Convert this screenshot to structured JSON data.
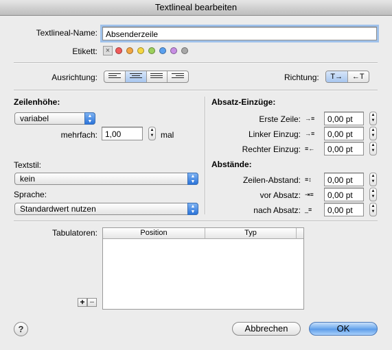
{
  "window": {
    "title": "Textlineal bearbeiten"
  },
  "name": {
    "label": "Textlineal-Name:",
    "value": "Absenderzeile"
  },
  "etikett": {
    "label": "Etikett:",
    "colors": [
      "#f05a5a",
      "#f1a542",
      "#f5d641",
      "#9bd05c",
      "#5aa0ef",
      "#c78ee3",
      "#a8a8a8"
    ]
  },
  "ausrichtung": {
    "label": "Ausrichtung:",
    "selected_index": 1
  },
  "richtung": {
    "label": "Richtung:",
    "options": [
      "T→",
      "←T"
    ],
    "selected_index": 0
  },
  "zeilenhoehe": {
    "heading": "Zeilenhöhe:",
    "mode": "variabel",
    "mehrfach_label": "mehrfach:",
    "mehrfach_value": "1,00",
    "unit": "mal"
  },
  "textstil": {
    "label": "Textstil:",
    "value": "kein"
  },
  "sprache": {
    "label": "Sprache:",
    "value": "Standardwert nutzen"
  },
  "absatz": {
    "heading": "Absatz-Einzüge:",
    "erste_zeile": {
      "label": "Erste Zeile:",
      "value": "0,00 pt"
    },
    "linker": {
      "label": "Linker Einzug:",
      "value": "0,00 pt"
    },
    "rechter": {
      "label": "Rechter Einzug:",
      "value": "0,00 pt"
    }
  },
  "abstaende": {
    "heading": "Abstände:",
    "zeilen": {
      "label": "Zeilen-Abstand:",
      "value": "0,00 pt"
    },
    "vor": {
      "label": "vor Absatz:",
      "value": "0,00 pt"
    },
    "nach": {
      "label": "nach Absatz:",
      "value": "0,00 pt"
    }
  },
  "tabulatoren": {
    "label": "Tabulatoren:",
    "columns": [
      "Position",
      "Typ"
    ],
    "add": "+",
    "remove": "−"
  },
  "buttons": {
    "help": "?",
    "cancel": "Abbrechen",
    "ok": "OK"
  }
}
